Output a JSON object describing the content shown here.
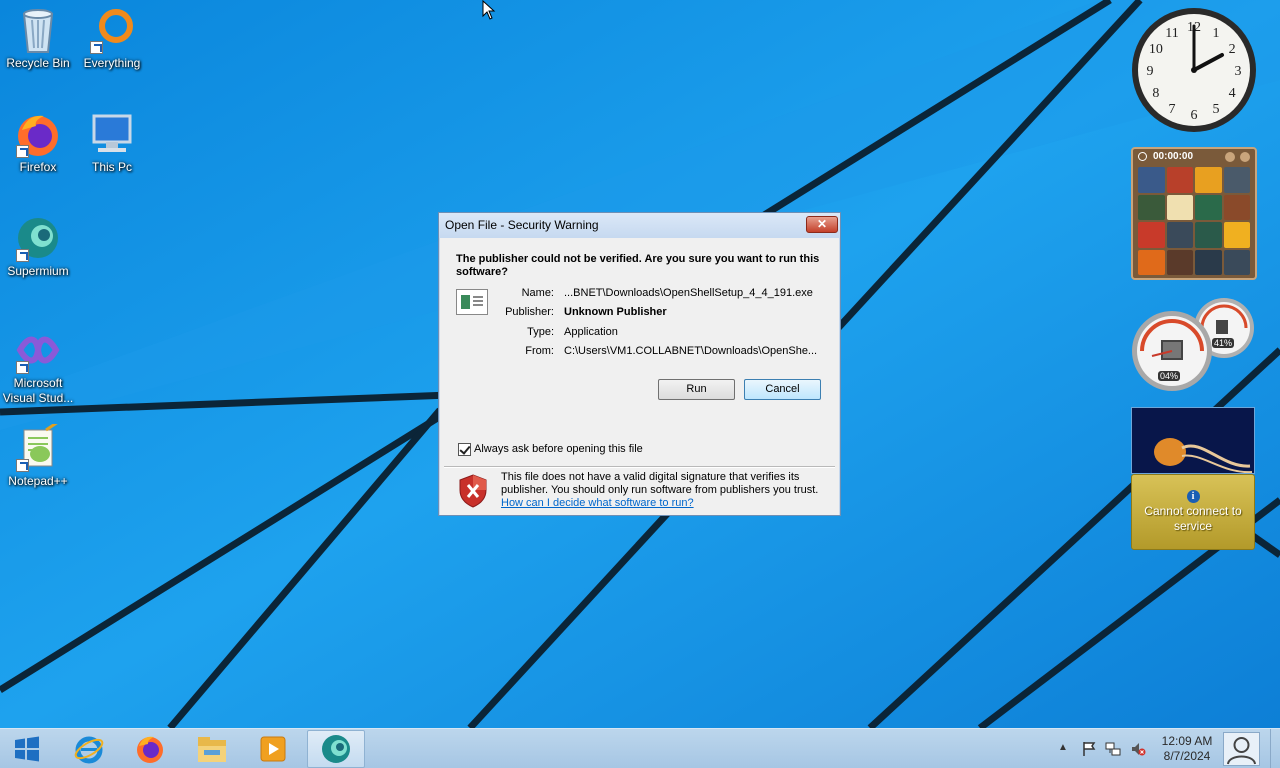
{
  "desktop": {
    "icons": [
      {
        "label": "Recycle Bin",
        "icon": "recycle-bin-icon"
      },
      {
        "label": "Everything",
        "icon": "everything-search-icon"
      },
      {
        "label": "Firefox",
        "icon": "firefox-icon"
      },
      {
        "label": "This Pc",
        "icon": "computer-icon"
      },
      {
        "label": "Supermium",
        "icon": "supermium-icon"
      },
      {
        "label": "Microsoft Visual Stud...",
        "icon": "visual-studio-icon"
      },
      {
        "label": "Notepad++",
        "icon": "notepad-plus-plus-icon"
      }
    ]
  },
  "gadgets": {
    "clock": {
      "time_shown": "2:10",
      "numerals": [
        "12",
        "1",
        "2",
        "3",
        "4",
        "5",
        "6",
        "7",
        "8",
        "9",
        "10",
        "11"
      ]
    },
    "puzzle": {
      "timer": "00:00:00"
    },
    "meter": {
      "cpu": "04%",
      "memory": "41%"
    },
    "weather": {
      "message": "Cannot connect to service"
    }
  },
  "dialog": {
    "title": "Open File - Security Warning",
    "close_label": "✕",
    "heading": "The publisher could not be verified.  Are you sure you want to run this software?",
    "fields": [
      {
        "label": "Name:",
        "value": "...BNET\\Downloads\\OpenShellSetup_4_4_191.exe",
        "bold": false
      },
      {
        "label": "Publisher:",
        "value": "Unknown Publisher",
        "bold": true
      },
      {
        "label": "Type:",
        "value": "Application",
        "bold": false
      },
      {
        "label": "From:",
        "value": "C:\\Users\\VM1.COLLABNET\\Downloads\\OpenShe...",
        "bold": false
      }
    ],
    "run_label": "Run",
    "cancel_label": "Cancel",
    "checkbox_label": "Always ask before opening this file",
    "checkbox_checked": true,
    "warning_text": "This file does not have a valid digital signature that verifies its publisher.  You should only run software from publishers you trust.",
    "warning_link": "How can I decide what software to run?"
  },
  "taskbar": {
    "time": "12:09 AM",
    "date": "8/7/2024",
    "pinned": [
      "internet-explorer-icon",
      "firefox-icon",
      "file-explorer-icon",
      "media-player-icon",
      "supermium-icon"
    ]
  },
  "colors": {
    "wallpaper": "#1a8fe0",
    "accent": "#0066cc",
    "taskbar": "#b3cfe8"
  }
}
